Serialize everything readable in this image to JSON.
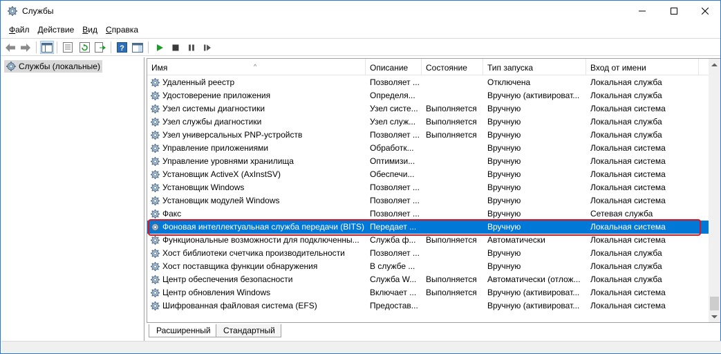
{
  "window": {
    "title": "Службы"
  },
  "menu": [
    {
      "label": "Файл",
      "key": "Ф",
      "rest": "айл"
    },
    {
      "label": "Действие",
      "key": "Д",
      "rest": "ействие"
    },
    {
      "label": "Вид",
      "key": "В",
      "rest": "ид"
    },
    {
      "label": "Справка",
      "key": "С",
      "rest": "правка"
    }
  ],
  "toolbar": {
    "icons": [
      "back-icon",
      "forward-icon",
      "show-hide-tree-icon",
      "properties-icon",
      "refresh-icon",
      "export-list-icon",
      "help-icon",
      "console-view-icon",
      "start-service-icon",
      "stop-service-icon",
      "pause-service-icon",
      "resume-service-icon"
    ]
  },
  "tree": {
    "item_label": "Службы (локальные)"
  },
  "columns": {
    "name": "Имя",
    "description": "Описание",
    "status": "Состояние",
    "startup": "Тип запуска",
    "logon": "Вход от имени"
  },
  "services": [
    {
      "name": "Удаленный реестр",
      "description": "Позволяет ...",
      "status": "",
      "startup": "Отключена",
      "logon": "Локальная служба"
    },
    {
      "name": "Удостоверение приложения",
      "description": "Определя...",
      "status": "",
      "startup": "Вручную (активироват...",
      "logon": "Локальная служба"
    },
    {
      "name": "Узел системы диагностики",
      "description": "Узел систе...",
      "status": "Выполняется",
      "startup": "Вручную",
      "logon": "Локальная система"
    },
    {
      "name": "Узел службы диагностики",
      "description": "Узел служ...",
      "status": "Выполняется",
      "startup": "Вручную",
      "logon": "Локальная служба"
    },
    {
      "name": "Узел универсальных PNP-устройств",
      "description": "Позволяет ...",
      "status": "Выполняется",
      "startup": "Вручную",
      "logon": "Локальная служба"
    },
    {
      "name": "Управление приложениями",
      "description": "Обработк...",
      "status": "",
      "startup": "Вручную",
      "logon": "Локальная система"
    },
    {
      "name": "Управление уровнями хранилища",
      "description": "Оптимизи...",
      "status": "",
      "startup": "Вручную",
      "logon": "Локальная система"
    },
    {
      "name": "Установщик ActiveX (AxInstSV)",
      "description": "Обеспечи...",
      "status": "",
      "startup": "Вручную",
      "logon": "Локальная система"
    },
    {
      "name": "Установщик Windows",
      "description": "Позволяет ...",
      "status": "",
      "startup": "Вручную",
      "logon": "Локальная система"
    },
    {
      "name": "Установщик модулей Windows",
      "description": "Позволяет ...",
      "status": "",
      "startup": "Вручную",
      "logon": "Локальная система"
    },
    {
      "name": "Факс",
      "description": "Позволяет ...",
      "status": "",
      "startup": "Вручную",
      "logon": "Сетевая служба"
    },
    {
      "name": "Фоновая интеллектуальная служба передачи (BITS)",
      "description": "Передает ...",
      "status": "",
      "startup": "Вручную",
      "logon": "Локальная система",
      "selected": true
    },
    {
      "name": "Функциональные возможности для подключенны...",
      "description": "Служба ф...",
      "status": "Выполняется",
      "startup": "Автоматически",
      "logon": "Локальная система"
    },
    {
      "name": "Хост библиотеки счетчика производительности",
      "description": "Позволяет ...",
      "status": "",
      "startup": "Вручную",
      "logon": "Локальная служба"
    },
    {
      "name": "Хост поставщика функции обнаружения",
      "description": "В службе ...",
      "status": "",
      "startup": "Вручную",
      "logon": "Локальная служба"
    },
    {
      "name": "Центр обеспечения безопасности",
      "description": "Служба W...",
      "status": "Выполняется",
      "startup": "Автоматически (отлож...",
      "logon": "Локальная служба"
    },
    {
      "name": "Центр обновления Windows",
      "description": "Включает ...",
      "status": "Выполняется",
      "startup": "Вручную (активироват...",
      "logon": "Локальная система"
    },
    {
      "name": "Шифрованная файловая система (EFS)",
      "description": "Предостав...",
      "status": "",
      "startup": "Вручную (активироват...",
      "logon": "Локальная система"
    }
  ],
  "tabs": {
    "extended": "Расширенный",
    "standard": "Стандартный"
  },
  "colors": {
    "selection": "#0078d7",
    "highlight": "#e0141e",
    "start_green": "#1a9e2a"
  }
}
